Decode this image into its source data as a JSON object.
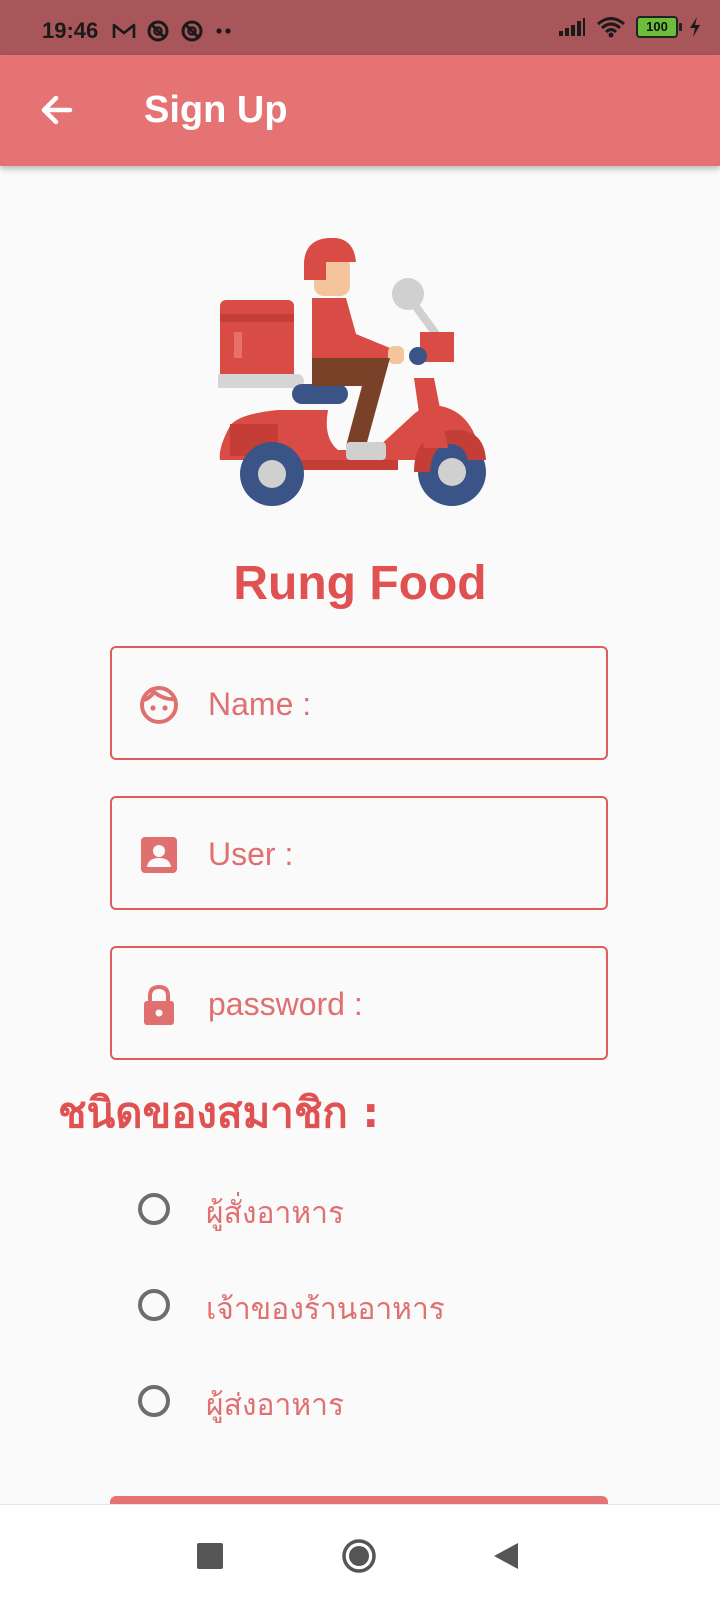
{
  "status_bar": {
    "time": "19:46",
    "left_icons": [
      "gmail-icon",
      "blocked-icon",
      "blocked-icon",
      "more-dots-icon"
    ],
    "right_icons": [
      "signal-icon",
      "wifi-icon",
      "battery-icon",
      "charging-icon"
    ],
    "battery": "100"
  },
  "app_bar": {
    "back_icon": "arrow-left-icon",
    "title": "Sign Up",
    "color": "#e57373"
  },
  "logo": {
    "icon": "delivery-scooter-icon"
  },
  "brand": "Rung Food",
  "form": {
    "name": {
      "icon": "face-icon",
      "placeholder": "Name :"
    },
    "user": {
      "icon": "account-box-icon",
      "placeholder": "User :"
    },
    "password": {
      "icon": "lock-icon",
      "placeholder": "password :"
    }
  },
  "member_type": {
    "heading": "ชนิดของสมาชิก :",
    "options": [
      "ผู้สั่งอาหาร",
      "เจ้าของร้านอาหาร",
      "ผู้ส่งอาหาร"
    ]
  },
  "nav_bar": {
    "icons": [
      "recents-square-icon",
      "home-circle-icon",
      "back-triangle-icon"
    ]
  },
  "colors": {
    "accent": "#e57373",
    "brand_text": "#e05252",
    "status_bar": "#a8565a"
  }
}
